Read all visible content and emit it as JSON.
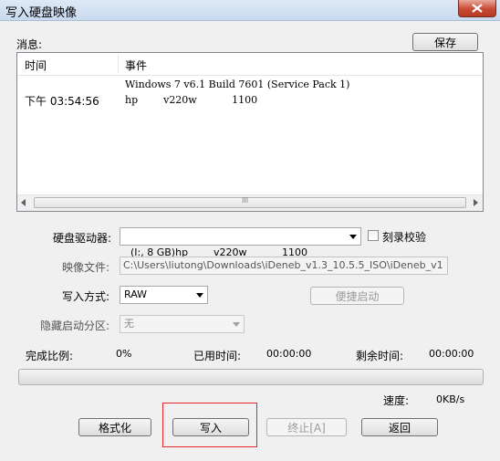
{
  "window": {
    "title": "写入硬盘映像"
  },
  "messages": {
    "label": "消息:",
    "save_label": "保存",
    "columns": [
      "时间",
      "事件"
    ],
    "rows": [
      {
        "time": "",
        "event": "Windows 7 v6.1 Build 7601 (Service Pack 1)"
      },
      {
        "time": "下午 03:54:56",
        "event": "hp        v220w           1100"
      }
    ],
    "scroll_thumb_glyph": "III"
  },
  "drive": {
    "label": "硬盘驱动器:",
    "value": "(I:, 8 GB)hp        v220w           1100",
    "verify_label": "刻录校验"
  },
  "image_file": {
    "label": "映像文件:",
    "value": "C:\\Users\\liutong\\Downloads\\iDeneb_v1.3_10.5.5_ISO\\iDeneb_v1"
  },
  "write_mode": {
    "label": "写入方式:",
    "value": "RAW",
    "quick_boot_label": "便捷启动"
  },
  "hidden_partition": {
    "label": "隐藏启动分区:",
    "value": "无"
  },
  "status": {
    "progress_label": "完成比例:",
    "progress_value": "0%",
    "progress_fraction": 0,
    "elapsed_label": "已用时间:",
    "elapsed_value": "00:00:00",
    "remaining_label": "剩余时间:",
    "remaining_value": "00:00:00",
    "speed_label": "速度:",
    "speed_value": "0KB/s"
  },
  "buttons": {
    "format": "格式化",
    "write": "写入",
    "abort": "终止[A]",
    "back": "返回"
  },
  "colors": {
    "highlight": "#e0272a"
  }
}
